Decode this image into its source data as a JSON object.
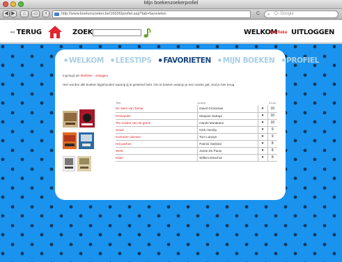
{
  "window": {
    "title": "Mijn boekenzoekerprofiel"
  },
  "browser": {
    "url": "http://www.boekenzoeker.be/16526/profiel.asp?tab=favorieten",
    "search_placeholder": "Q- Google",
    "back_label": "◀",
    "forward_label": "▶",
    "reload_label": "C"
  },
  "header": {
    "back_label": "TERUG",
    "search_label": "ZOEK",
    "welcome_label": "WELKOM",
    "user_name": "Marfieke",
    "logout_label": "UITLOGGEN"
  },
  "nav": {
    "items": [
      "WELKOM",
      "LEESTIPS",
      "FAVORIETEN",
      "MIJN BOEKEN",
      "PROFIEL"
    ],
    "active": "FAVORIETEN"
  },
  "login_status": {
    "prefix": "Ingelogd als",
    "user_link": "Marfieke",
    "separator": " - ",
    "logout_link": "uitloggen"
  },
  "intro": "Hier worden alle boeken bijgehouden waarop jij al gestemd hebt. Om te boeken waarop je een reactie gaf, vind je hier terug.",
  "table": {
    "headers": {
      "title": "Titel",
      "author": "Auteur",
      "score": "Score"
    },
    "rows": [
      {
        "title": "De stem van Tamar",
        "author": "David Grossman",
        "score": "10"
      },
      {
        "title": "Persepolis",
        "author": "Marjane Satrapi",
        "score": "10"
      },
      {
        "title": "Ten zuiden van de grens",
        "author": "Haruki Murakami",
        "score": "10"
      },
      {
        "title": "Smuk",
        "author": "Nick Hornby",
        "score": "9"
      },
      {
        "title": "Komonen dansen",
        "author": "Tom Lanoye",
        "score": "9"
      },
      {
        "title": "Het parfum",
        "author": "Patrick Süskind",
        "score": "8"
      },
      {
        "title": "Werk",
        "author": "Josse De Pauw",
        "score": "8"
      },
      {
        "title": "Kaas",
        "author": "Willem Elsschot",
        "score": "8"
      }
    ]
  },
  "colors": {
    "page_blue": "#1a93ee",
    "accent_red": "#e1262d",
    "nav_active": "#17457b",
    "nav_inactive": "#a9cfe4"
  }
}
